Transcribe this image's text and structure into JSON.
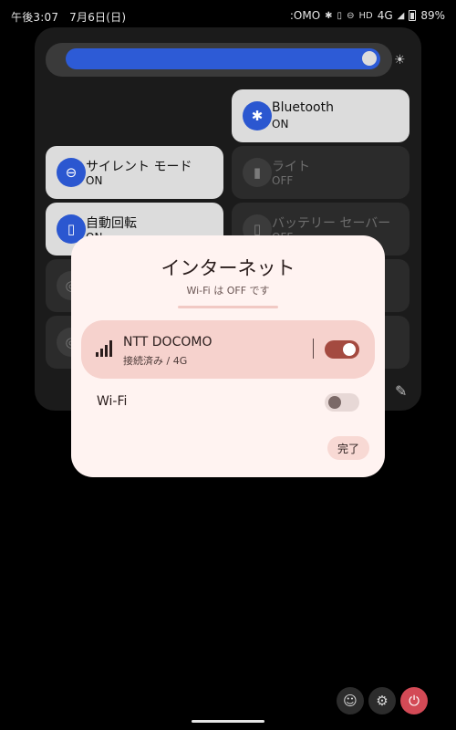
{
  "status_bar": {
    "time": "午後3:07",
    "date": "7月6日(日)",
    "carrier": ":OMO",
    "network": "4G",
    "battery": "89%"
  },
  "quick_settings": {
    "brightness_fraction": 0.97,
    "tiles": [
      {
        "label": "Bluetooth",
        "state": "ON"
      },
      {
        "label": "サイレント モード",
        "state": "ON"
      },
      {
        "label": "ライト",
        "state": "OFF"
      },
      {
        "label": "自動回転",
        "state": "ON"
      },
      {
        "label": "バッテリー セーバー",
        "state": "OFF"
      }
    ]
  },
  "dialog": {
    "title": "インターネット",
    "subtitle": "Wi-Fi は OFF です",
    "network": {
      "name": "NTT DOCOMO",
      "status": "接続済み / 4G",
      "enabled": true
    },
    "wifi": {
      "label": "Wi-Fi",
      "enabled": false
    },
    "done_label": "完了"
  },
  "colors": {
    "accent_blue": "#2b57d0",
    "toggle_on": "#a44a40",
    "power": "#d34a56"
  }
}
